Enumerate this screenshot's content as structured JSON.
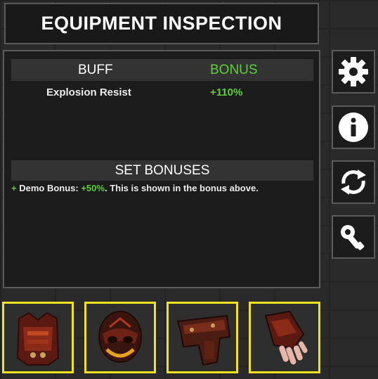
{
  "title": "EQUIPMENT INSPECTION",
  "buff_table": {
    "col_buff": "BUFF",
    "col_bonus": "BONUS",
    "rows": [
      {
        "name": "Explosion Resist",
        "value": "+110%"
      }
    ]
  },
  "set_bonuses": {
    "title": "SET BONUSES",
    "line": {
      "prefix": "+",
      "label": "Demo Bonus: ",
      "value": "+50%",
      "suffix": ". This is shown in the bonus above."
    }
  },
  "side_buttons": [
    {
      "icon": "gear-icon"
    },
    {
      "icon": "info-icon"
    },
    {
      "icon": "swap-icon"
    },
    {
      "icon": "grinder-icon"
    }
  ],
  "equipment_slots": [
    {
      "icon": "chest-armor-icon"
    },
    {
      "icon": "helmet-icon"
    },
    {
      "icon": "leg-armor-icon"
    },
    {
      "icon": "glove-icon"
    }
  ],
  "colors": {
    "accent_green": "#5fcf3a",
    "slot_border": "#f3e21f",
    "panel_bg": "#1c1c1c",
    "panel_border": "#5a5a5a"
  }
}
